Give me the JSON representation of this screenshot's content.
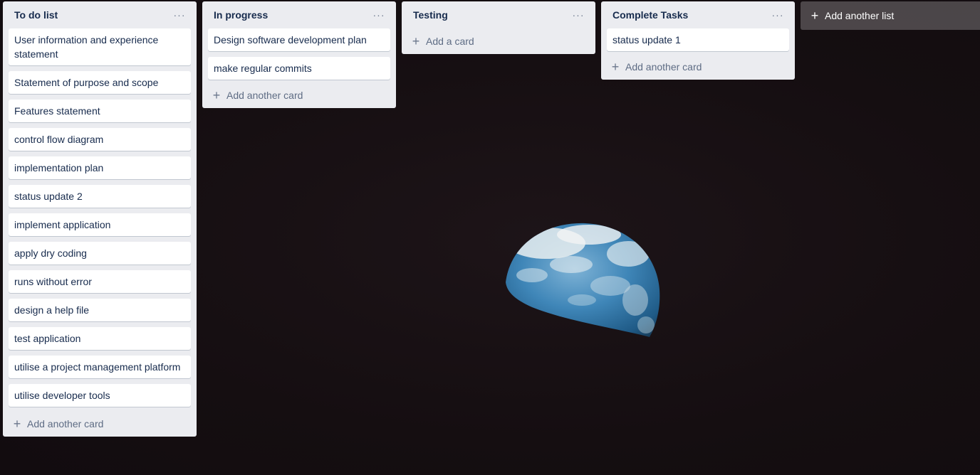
{
  "lists": [
    {
      "title": "To do list",
      "menu": "···",
      "cards": [
        "User information and experience statement",
        "Statement of purpose and scope",
        "Features statement",
        "control flow diagram",
        "implementation plan",
        "status update 2",
        "implement application",
        "apply dry coding",
        "runs without error",
        "design a help file",
        "test application",
        "utilise a project management platform",
        "utilise developer tools"
      ],
      "add_label": "Add another card"
    },
    {
      "title": "In progress",
      "menu": "···",
      "cards": [
        "Design software development plan",
        "make regular commits"
      ],
      "add_label": "Add another card"
    },
    {
      "title": "Testing",
      "menu": "···",
      "cards": [],
      "add_label": "Add a card"
    },
    {
      "title": "Complete Tasks",
      "menu": "···",
      "cards": [
        "status update 1"
      ],
      "add_label": "Add another card"
    }
  ],
  "add_list_label": "Add another list",
  "plus_icon": "+",
  "colors": {
    "list_bg": "#ebecf0",
    "card_bg": "#ffffff",
    "text": "#172b4d",
    "muted": "#5e6c84",
    "board_bg": "#160f12"
  }
}
